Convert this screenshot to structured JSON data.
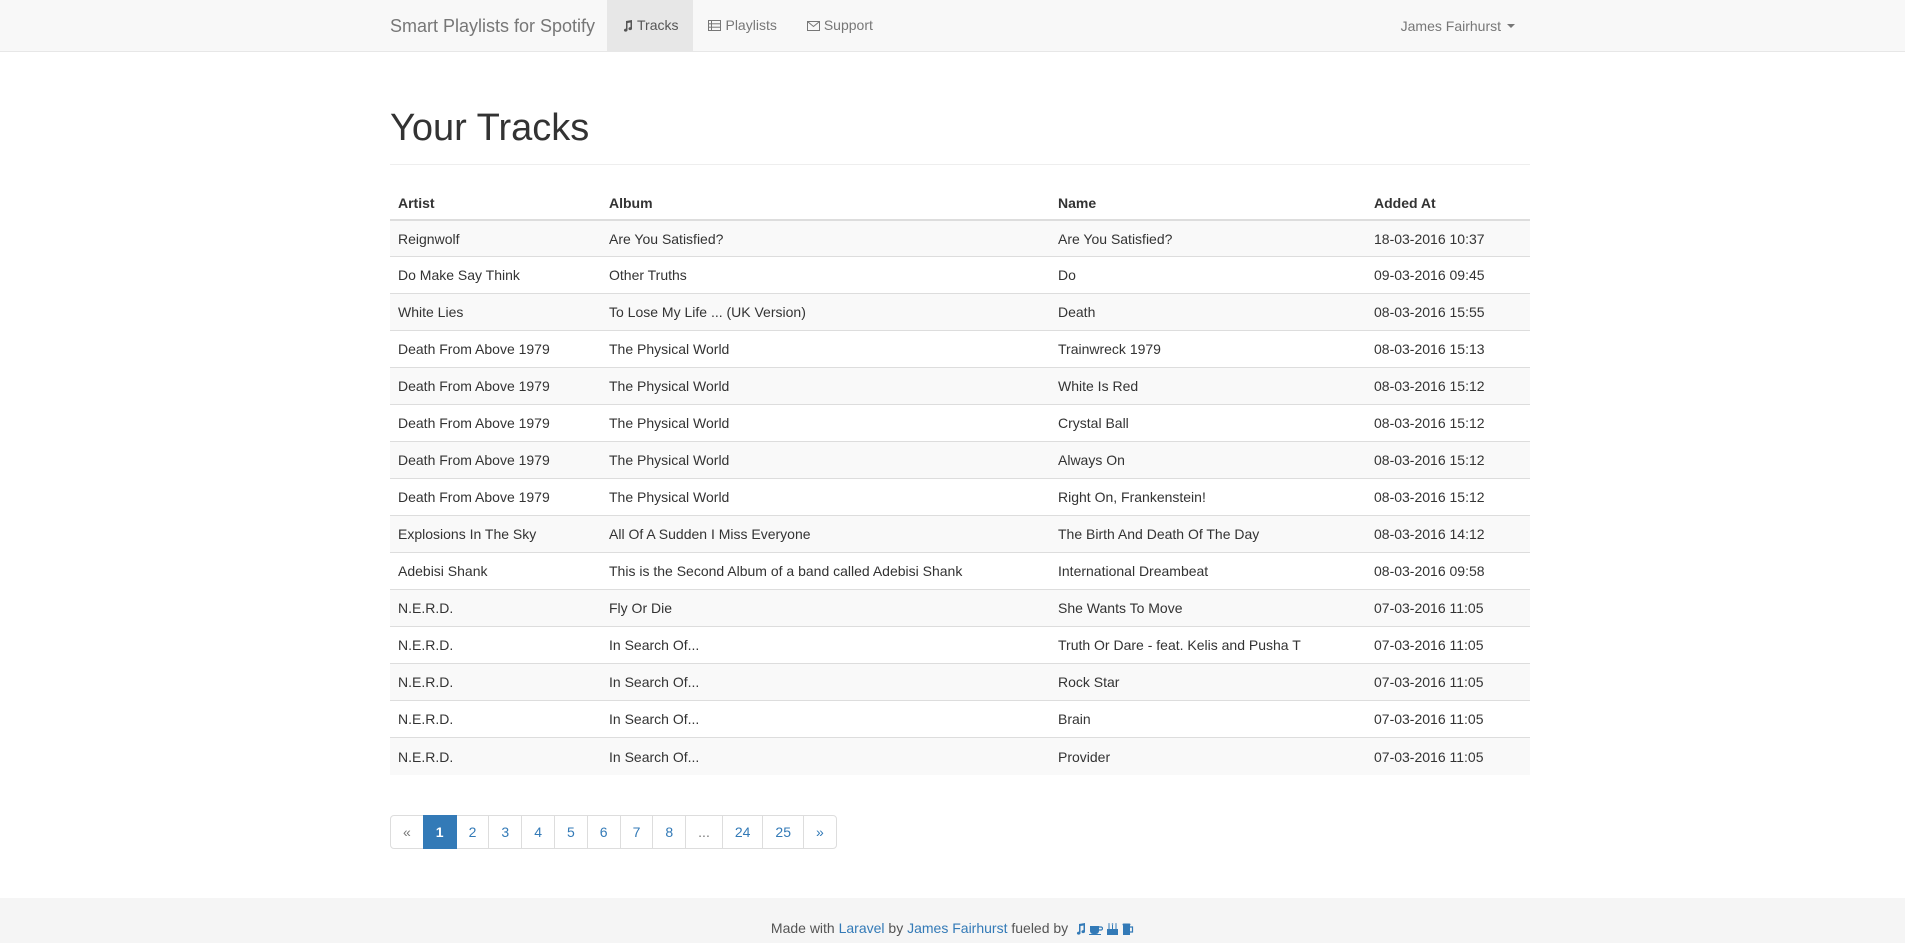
{
  "nav": {
    "brand": "Smart Playlists for Spotify",
    "items": [
      {
        "label": "Tracks",
        "icon": "music-icon",
        "active": true
      },
      {
        "label": "Playlists",
        "icon": "list-icon",
        "active": false
      },
      {
        "label": "Support",
        "icon": "envelope-icon",
        "active": false
      }
    ],
    "user": "James Fairhurst"
  },
  "page": {
    "title": "Your Tracks"
  },
  "table": {
    "headers": [
      "Artist",
      "Album",
      "Name",
      "Added At"
    ],
    "rows": [
      [
        "Reignwolf",
        "Are You Satisfied?",
        "Are You Satisfied?",
        "18-03-2016 10:37"
      ],
      [
        "Do Make Say Think",
        "Other Truths",
        "Do",
        "09-03-2016 09:45"
      ],
      [
        "White Lies",
        "To Lose My Life ... (UK Version)",
        "Death",
        "08-03-2016 15:55"
      ],
      [
        "Death From Above 1979",
        "The Physical World",
        "Trainwreck 1979",
        "08-03-2016 15:13"
      ],
      [
        "Death From Above 1979",
        "The Physical World",
        "White Is Red",
        "08-03-2016 15:12"
      ],
      [
        "Death From Above 1979",
        "The Physical World",
        "Crystal Ball",
        "08-03-2016 15:12"
      ],
      [
        "Death From Above 1979",
        "The Physical World",
        "Always On",
        "08-03-2016 15:12"
      ],
      [
        "Death From Above 1979",
        "The Physical World",
        "Right On, Frankenstein!",
        "08-03-2016 15:12"
      ],
      [
        "Explosions In The Sky",
        "All Of A Sudden I Miss Everyone",
        "The Birth And Death Of The Day",
        "08-03-2016 14:12"
      ],
      [
        "Adebisi Shank",
        "This is the Second Album of a band called Adebisi Shank",
        "International Dreambeat",
        "08-03-2016 09:58"
      ],
      [
        "N.E.R.D.",
        "Fly Or Die",
        "She Wants To Move",
        "07-03-2016 11:05"
      ],
      [
        "N.E.R.D.",
        "In Search Of...",
        "Truth Or Dare - feat. Kelis and Pusha T",
        "07-03-2016 11:05"
      ],
      [
        "N.E.R.D.",
        "In Search Of...",
        "Rock Star",
        "07-03-2016 11:05"
      ],
      [
        "N.E.R.D.",
        "In Search Of...",
        "Brain",
        "07-03-2016 11:05"
      ],
      [
        "N.E.R.D.",
        "In Search Of...",
        "Provider",
        "07-03-2016 11:05"
      ]
    ]
  },
  "pagination": {
    "items": [
      "«",
      "1",
      "2",
      "3",
      "4",
      "5",
      "6",
      "7",
      "8",
      "...",
      "24",
      "25",
      "»"
    ],
    "active": "1"
  },
  "footer": {
    "made_with": "Made with",
    "framework": "Laravel",
    "by": "by",
    "author": "James Fairhurst",
    "fueled_by": "fueled by",
    "icons": [
      "music-icon",
      "coffee-icon",
      "cake-icon",
      "beer-icon"
    ],
    "icon_color": "#337ab7"
  },
  "colors": {
    "accent": "#337ab7",
    "navbar_bg": "#f8f8f8"
  }
}
